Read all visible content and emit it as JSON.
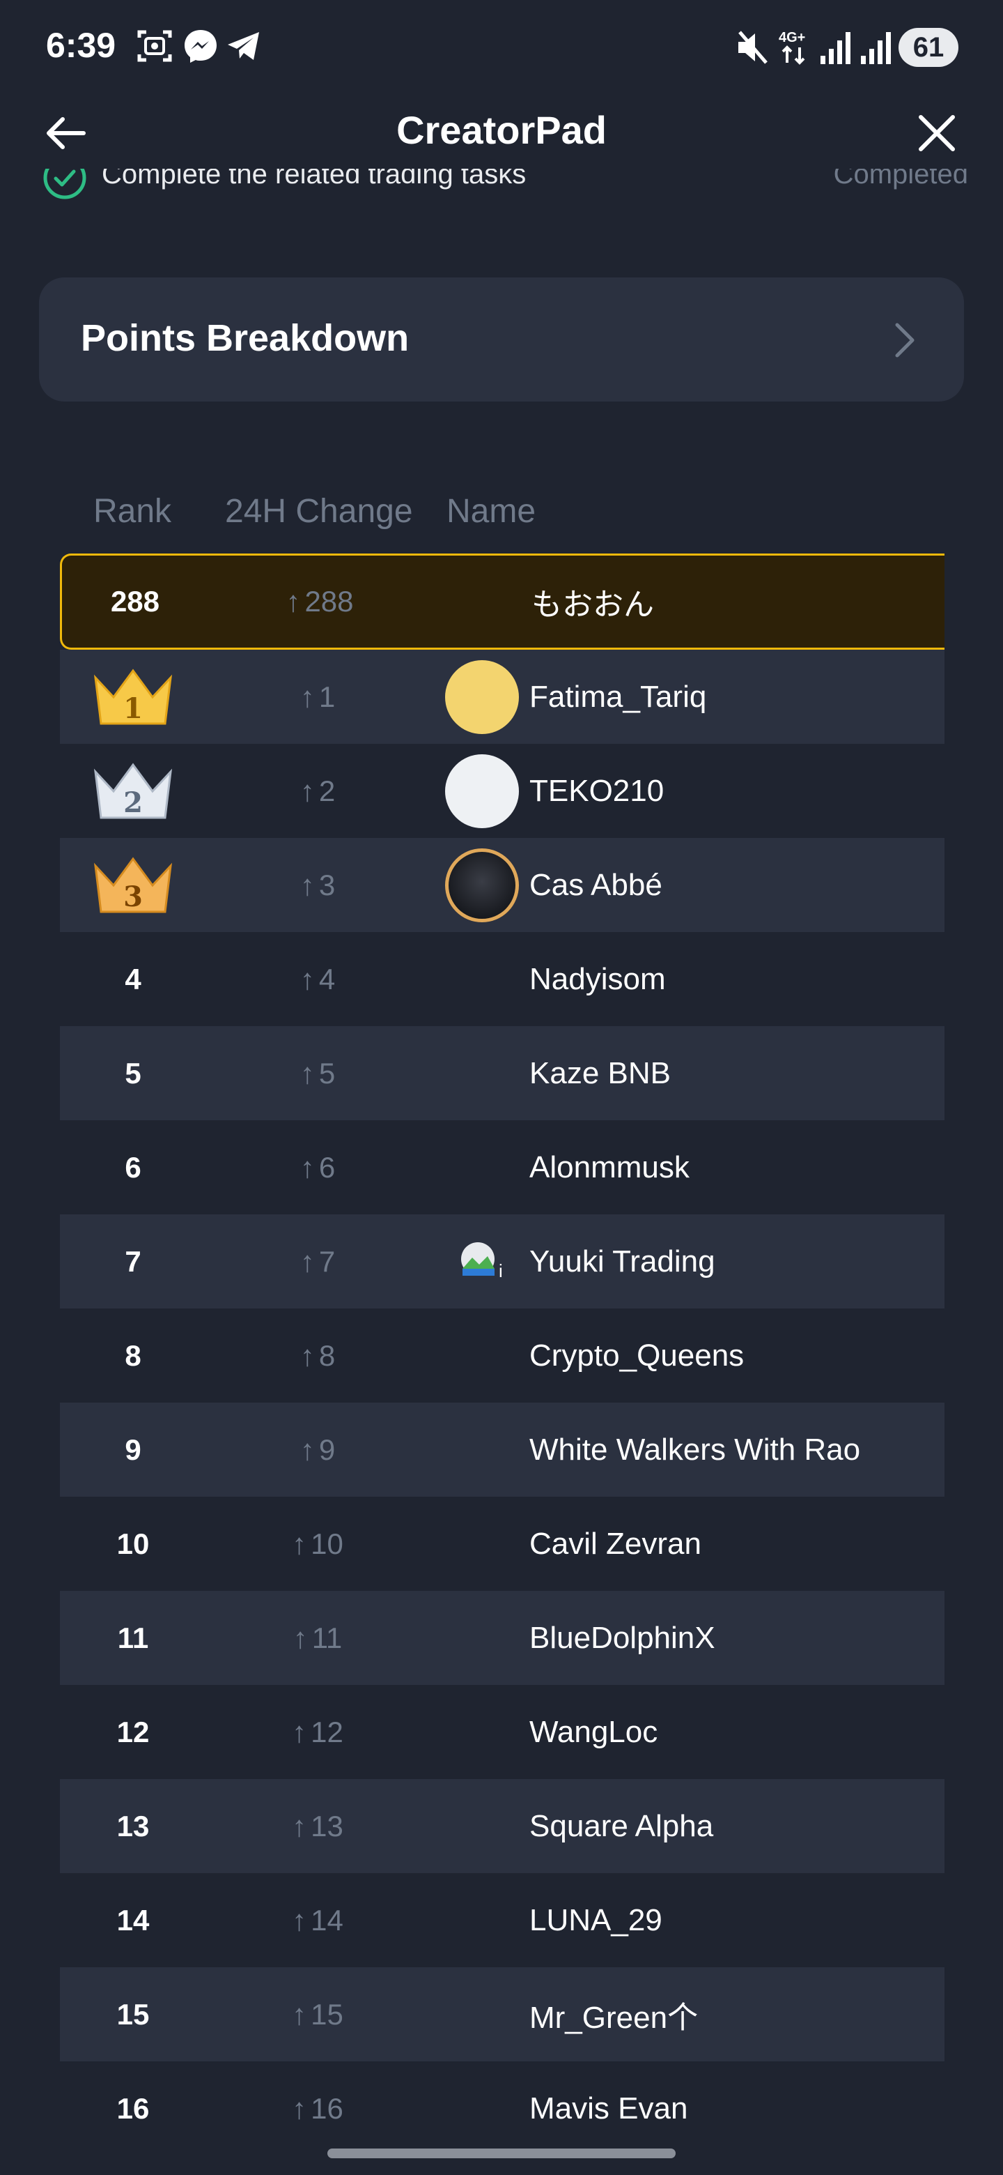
{
  "status_bar": {
    "time": "6:39",
    "network": "4G+",
    "battery": "61",
    "left_icons": [
      "screenshot-icon",
      "messenger-icon",
      "telegram-icon"
    ],
    "right_icons": [
      "mute-icon",
      "data-icon",
      "signal-icon",
      "signal-icon"
    ]
  },
  "header": {
    "title": "CreatorPad",
    "back_icon": "arrow-left-icon",
    "close_icon": "close-icon"
  },
  "task": {
    "label": "Complete the related trading tasks",
    "status": "Completed",
    "icon": "check-circle-icon",
    "icon_color": "#2ebd85"
  },
  "points_breakdown": {
    "label": "Points Breakdown",
    "icon": "chevron-right-icon"
  },
  "leaderboard": {
    "columns": [
      "Rank",
      "24H Change",
      "Name"
    ],
    "me": {
      "rank": "288",
      "change": "288",
      "name": "もおおん",
      "highlight_color": "#f0b90b"
    },
    "rows": [
      {
        "rank": "1",
        "change": "1",
        "name": "Fatima_Tariq",
        "avatar": "yellow-circle",
        "crown": "gold"
      },
      {
        "rank": "2",
        "change": "2",
        "name": "TEKO210",
        "avatar": "white-circle",
        "crown": "silver"
      },
      {
        "rank": "3",
        "change": "3",
        "name": "Cas Abbé",
        "avatar": "photo",
        "crown": "bronze"
      },
      {
        "rank": "4",
        "change": "4",
        "name": "Nadyisom"
      },
      {
        "rank": "5",
        "change": "5",
        "name": "Kaze BNB"
      },
      {
        "rank": "6",
        "change": "6",
        "name": "Alonmmusk"
      },
      {
        "rank": "7",
        "change": "7",
        "name": "Yuuki Trading",
        "avatar": "broken-image"
      },
      {
        "rank": "8",
        "change": "8",
        "name": "Crypto_Queens"
      },
      {
        "rank": "9",
        "change": "9",
        "name": "White Walkers With Rao"
      },
      {
        "rank": "10",
        "change": "10",
        "name": "Cavil Zevran"
      },
      {
        "rank": "11",
        "change": "11",
        "name": "BlueDolphinX"
      },
      {
        "rank": "12",
        "change": "12",
        "name": "WangLoc"
      },
      {
        "rank": "13",
        "change": "13",
        "name": "Square Alpha"
      },
      {
        "rank": "14",
        "change": "14",
        "name": "LUNA_29"
      },
      {
        "rank": "15",
        "change": "15",
        "name": "Mr_Green个"
      },
      {
        "rank": "16",
        "change": "16",
        "name": "Mavis Evan"
      }
    ],
    "change_arrow": "↑"
  }
}
